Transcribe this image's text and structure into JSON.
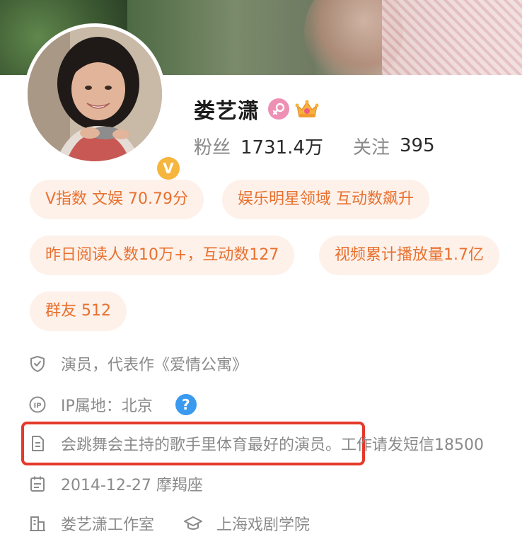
{
  "profile": {
    "name": "娄艺潇",
    "gender_icon": "female-icon",
    "crown_icon": "crown-icon",
    "verified_badge": "V",
    "fans_label": "粉丝",
    "fans_value": "1731.4万",
    "following_label": "关注",
    "following_value": "395"
  },
  "tags": [
    {
      "text": "V指数 文娱 70.79分"
    },
    {
      "text": "娱乐明星领域 互动数飙升"
    },
    {
      "text": "昨日阅读人数10万+，互动数127"
    },
    {
      "text": "视频累计播放量1.7亿"
    },
    {
      "text": "群友 512"
    }
  ],
  "info": {
    "verification": "演员，代表作《爱情公寓》",
    "ip_location": "IP属地：北京",
    "bio": "会跳舞会主持的歌手里体育最好的演员。工作请发短信18500",
    "birthday": "2014-12-27 摩羯座",
    "company": "娄艺潇工作室",
    "school": "上海戏剧学院"
  },
  "colors": {
    "tag_bg": "#fdf1ea",
    "tag_text": "#e8702e",
    "highlight_border": "#e43a2b",
    "verified_badge": "#f6b53d",
    "help_icon": "#3a9af0"
  }
}
